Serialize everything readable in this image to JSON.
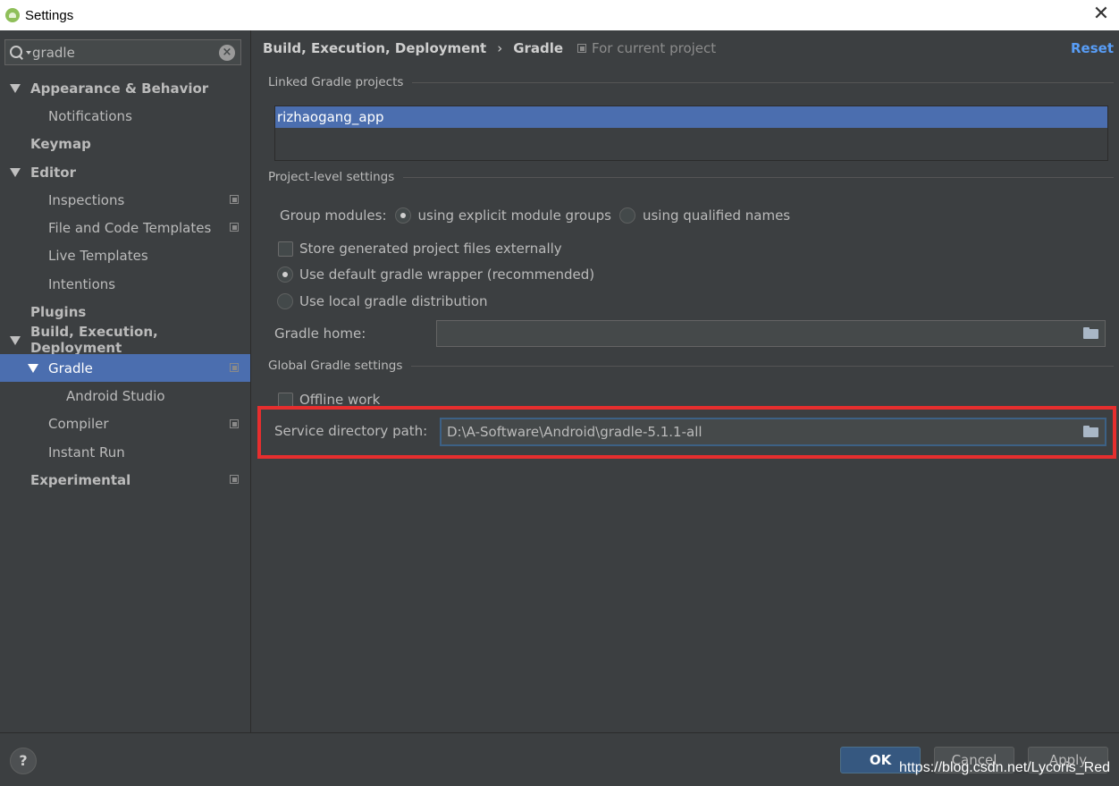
{
  "window": {
    "title": "Settings"
  },
  "search": {
    "value": "gradle"
  },
  "tree": [
    {
      "label": "Appearance & Behavior",
      "level": 0,
      "bold": true,
      "expanded": true,
      "copy": false
    },
    {
      "label": "Notifications",
      "level": 1,
      "bold": false,
      "copy": false
    },
    {
      "label": "Keymap",
      "level": 0,
      "bold": true,
      "copy": false
    },
    {
      "label": "Editor",
      "level": 0,
      "bold": true,
      "expanded": true,
      "copy": false
    },
    {
      "label": "Inspections",
      "level": 1,
      "bold": false,
      "copy": true
    },
    {
      "label": "File and Code Templates",
      "level": 1,
      "bold": false,
      "copy": true
    },
    {
      "label": "Live Templates",
      "level": 1,
      "bold": false,
      "copy": false
    },
    {
      "label": "Intentions",
      "level": 1,
      "bold": false,
      "copy": false
    },
    {
      "label": "Plugins",
      "level": 0,
      "bold": true,
      "copy": false
    },
    {
      "label": "Build, Execution, Deployment",
      "level": 0,
      "bold": true,
      "expanded": true,
      "copy": false
    },
    {
      "label": "Gradle",
      "level": 1,
      "bold": false,
      "expanded": true,
      "selected": true,
      "copy": true
    },
    {
      "label": "Android Studio",
      "level": 2,
      "bold": false,
      "copy": false
    },
    {
      "label": "Compiler",
      "level": 1,
      "bold": false,
      "copy": true
    },
    {
      "label": "Instant Run",
      "level": 1,
      "bold": false,
      "copy": false
    },
    {
      "label": "Experimental",
      "level": 0,
      "bold": true,
      "copy": true
    }
  ],
  "header": {
    "breadcrumb_parent": "Build, Execution, Deployment",
    "breadcrumb_sep": "›",
    "breadcrumb_current": "Gradle",
    "scope": "For current project",
    "reset": "Reset"
  },
  "linked": {
    "title": "Linked Gradle projects",
    "projects": [
      "rizhaogang_app"
    ]
  },
  "project_level": {
    "title": "Project-level settings",
    "group_modules_label": "Group modules:",
    "opt_explicit": "using explicit module groups",
    "opt_qualified": "using qualified names",
    "store_external": "Store generated project files externally",
    "default_wrapper": "Use default gradle wrapper (recommended)",
    "local_distribution": "Use local gradle distribution",
    "gradle_home_label": "Gradle home:",
    "gradle_home_value": ""
  },
  "global": {
    "title": "Global Gradle settings",
    "offline_work": "Offline work",
    "service_dir_label": "Service directory path:",
    "service_dir_value": "D:\\A-Software\\Android\\gradle-5.1.1-all"
  },
  "footer": {
    "help": "?",
    "ok": "OK",
    "cancel": "Cancel",
    "apply": "Apply",
    "watermark": "https://blog.csdn.net/Lycoris_Red"
  },
  "colors": {
    "background": "#3c3f41",
    "selection": "#4b6eaf",
    "link": "#589df6",
    "highlight_box": "#e62e2e",
    "primary_button": "#365880"
  }
}
